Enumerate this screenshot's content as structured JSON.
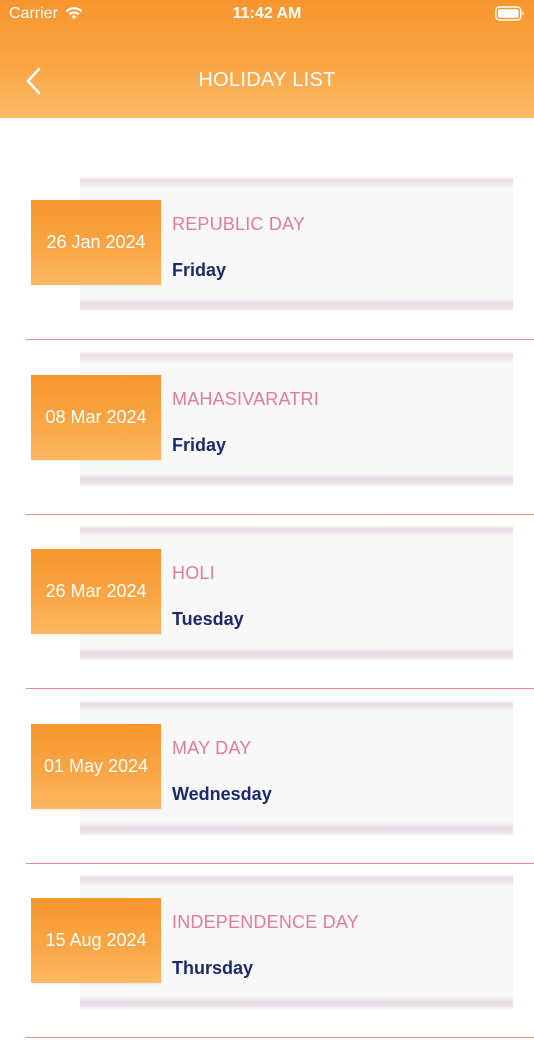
{
  "status_bar": {
    "carrier": "Carrier",
    "time": "11:42 AM"
  },
  "nav": {
    "title": "HOLIDAY LIST",
    "back_icon": "chevron-left-icon"
  },
  "colors": {
    "header_orange": "#f7962e",
    "name_pink": "#e47c95",
    "weekday_navy": "#1d2a6b",
    "divider": "#ef8a92"
  },
  "holidays": [
    {
      "date": "26 Jan 2024",
      "name": "REPUBLIC DAY",
      "weekday": "Friday"
    },
    {
      "date": "08 Mar 2024",
      "name": "MAHASIVARATRI",
      "weekday": "Friday"
    },
    {
      "date": "26 Mar 2024",
      "name": "HOLI",
      "weekday": "Tuesday"
    },
    {
      "date": "01 May 2024",
      "name": "MAY DAY",
      "weekday": "Wednesday"
    },
    {
      "date": "15 Aug 2024",
      "name": "INDEPENDENCE DAY",
      "weekday": "Thursday"
    }
  ]
}
